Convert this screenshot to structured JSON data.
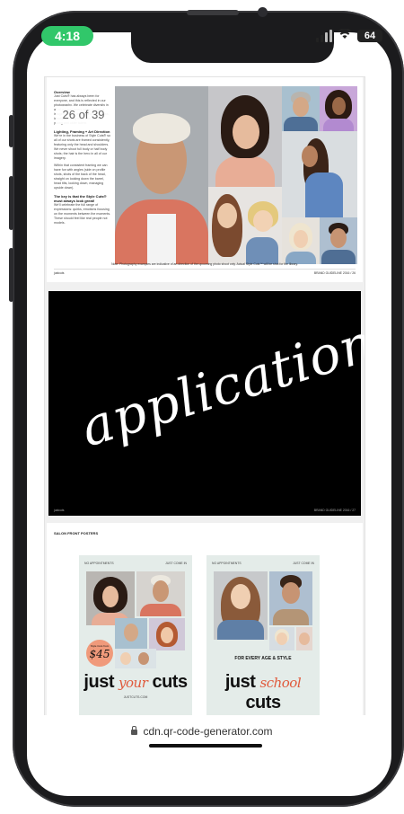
{
  "status_bar": {
    "time": "4:18",
    "battery": "64",
    "icons": [
      "signal-icon",
      "wifi-icon",
      "battery-icon"
    ]
  },
  "page_counter": "26 of 39",
  "page1": {
    "overview_heading": "Overview",
    "overview_text": "Just Cuts® has always been for everyone, and this is reflected in our photography. We celebrate diversity in all of our customers when selecting imagery for our advertising executions, ideally featuring male and female, young and older talent.",
    "lighting_heading": "Lighting, Framing + Art Direction",
    "lighting_text": "We're in the business of Style Cuts® so all of our shots are framed consistently, featuring only the head and shoulders. We never shoot full body or half body shots; the hair is the hero in all of our imagery.",
    "framing_text": "Within that consistent framing we can have fun with angles (side on profile shots, shots of the back of the head, straight on looking down the barrel, head tilts, looking down, managing upside down).",
    "key_heading": "The key is that the Style Cuts® must always look great!",
    "key_text": "We'll celebrate the full range of expressions: quirks, emotions focusing on the moments between the moments. These should feel like real people not models.",
    "caption": "Note: Photography examples are indicative of art direction of the upcoming photo shoot only. Actual Style Cuts™ will be shot for the library.",
    "footer_left": "justcuts",
    "footer_right": "BRAND GUIDELINE 2016 / 26"
  },
  "page2": {
    "script_word": "applications",
    "footer_left": "justcuts",
    "footer_right": "BRAND GUIDELINE 2016 / 27"
  },
  "page3": {
    "title": "SALON FRONT POSTERS",
    "poster1": {
      "top_left": "NO APPOINTMENTS",
      "top_right": "JUST COME IN",
      "price_label": "Style Cuts from",
      "price": "$45",
      "slogan_pre": "just",
      "slogan_script": "your",
      "slogan_post": "cuts",
      "url": "JUSTCUTS.COM"
    },
    "poster2": {
      "top_left": "NO APPOINTMENTS",
      "top_right": "JUST COME IN",
      "tagline": "FOR EVERY AGE & STYLE",
      "slogan_pre": "just",
      "slogan_script": "school",
      "slogan_post": "cuts"
    }
  },
  "url_bar": {
    "url": "cdn.qr-code-generator.com"
  }
}
